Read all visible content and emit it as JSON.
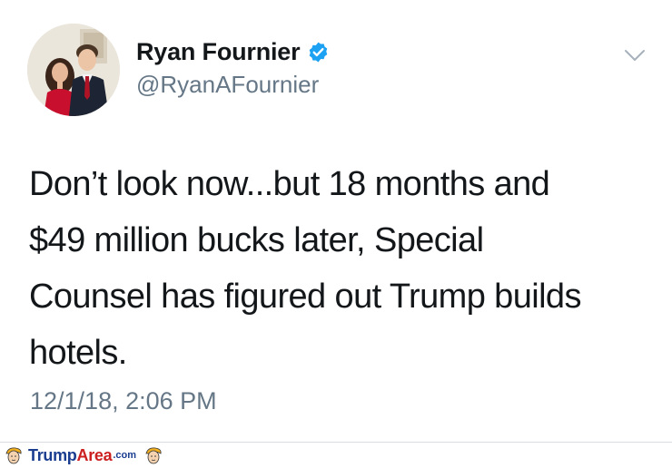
{
  "user": {
    "display_name": "Ryan Fournier",
    "handle": "@RyanAFournier",
    "verified": true,
    "avatar_icon": "profile-photo"
  },
  "tweet": {
    "text": "Don’t look now...but 18 months and\n$49 million bucks later, Special\nCounsel has figured out Trump builds\nhotels.",
    "timestamp": "12/1/18, 2:06 PM"
  },
  "menu": {
    "icon": "chevron-down-icon"
  },
  "watermark": {
    "brand_part1": "Trump",
    "brand_part2": "Area",
    "brand_suffix": ".com",
    "icon": "trump-head-icon"
  },
  "colors": {
    "text_primary": "#14171a",
    "text_secondary": "#657786",
    "verified_blue": "#1da1f2",
    "brand_blue": "#1a3d8f",
    "brand_red": "#cc1f1f"
  }
}
